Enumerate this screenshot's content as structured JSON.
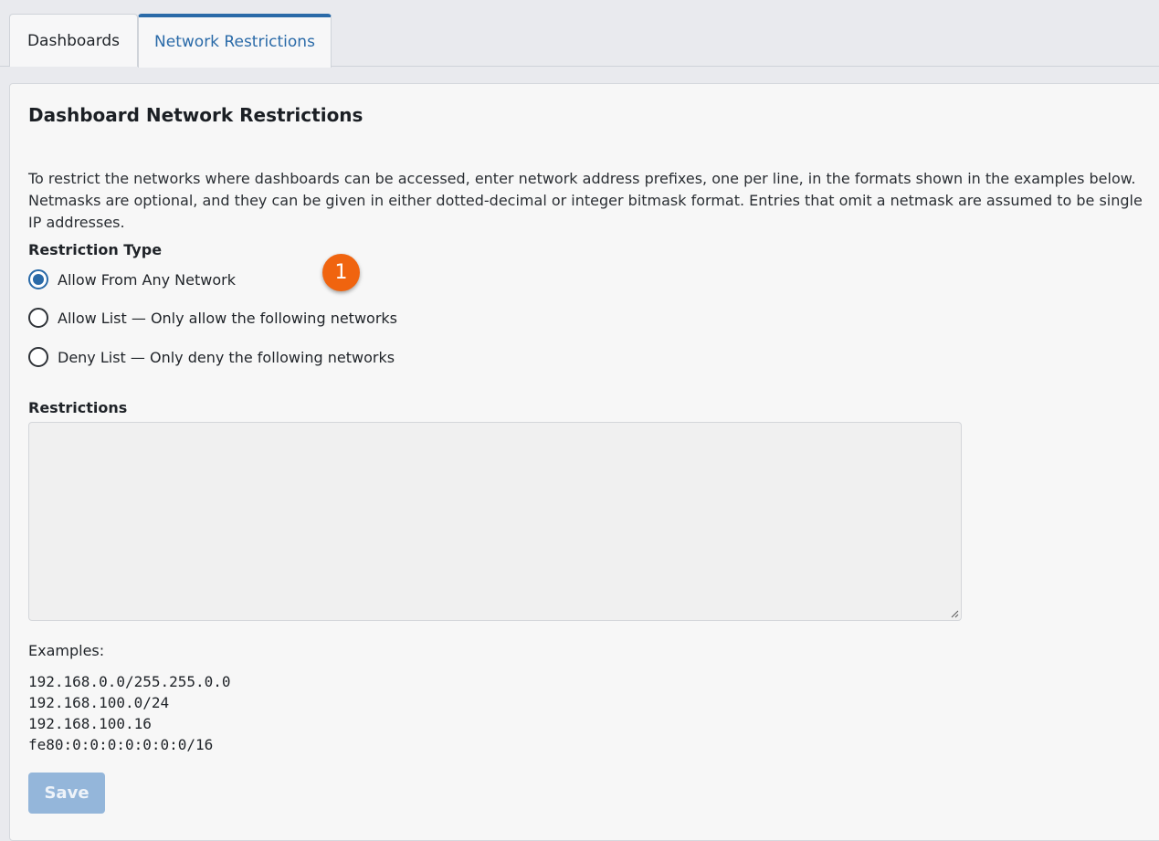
{
  "tabs": [
    {
      "label": "Dashboards",
      "active": false
    },
    {
      "label": "Network Restrictions",
      "active": true
    }
  ],
  "page": {
    "title": "Dashboard Network Restrictions",
    "description": "To restrict the networks where dashboards can be accessed, enter network address prefixes, one per line, in the formats shown in the examples below. Netmasks are optional, and they can be given in either dotted-decimal or integer bitmask format. Entries that omit a netmask are assumed to be single IP addresses."
  },
  "restriction_type": {
    "label": "Restriction Type",
    "options": [
      {
        "label": "Allow From Any Network",
        "checked": true
      },
      {
        "label": "Allow List — Only allow the following networks",
        "checked": false
      },
      {
        "label": "Deny List — Only deny the following networks",
        "checked": false
      }
    ]
  },
  "callout_badge": "1",
  "restrictions": {
    "label": "Restrictions",
    "value": "",
    "disabled": true
  },
  "examples": {
    "label": "Examples:",
    "lines": [
      "192.168.0.0/255.255.0.0",
      "192.168.100.0/24",
      "192.168.100.16",
      "fe80:0:0:0:0:0:0:0/16"
    ]
  },
  "save_button": {
    "label": "Save",
    "disabled": true
  },
  "colors": {
    "accent": "#2a6aa8",
    "badge": "#f0640f",
    "save_disabled": "#94b6da"
  }
}
